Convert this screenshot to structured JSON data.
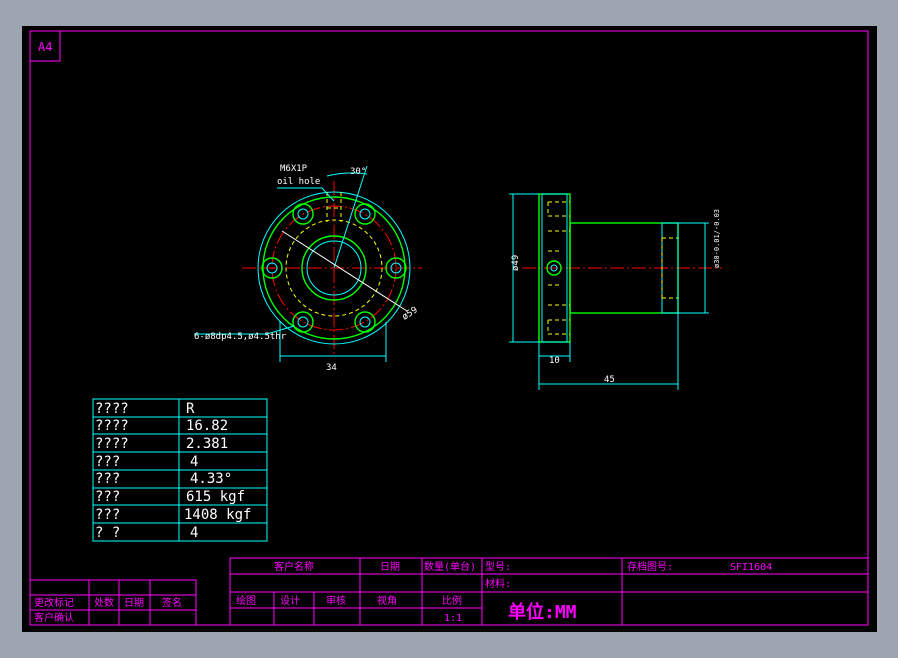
{
  "sheet": {
    "size": "A4"
  },
  "front_view": {
    "thread_label": "M6X1P",
    "oil_hole_label": "oil hole",
    "angle_label": "30°",
    "diameter_label": "ø59",
    "holes_label": "6-ø8dp4.5,ø4.5thr",
    "width_dim": "34"
  },
  "side_view": {
    "flange_dia": "ø49",
    "body_dia": "ø30-0.01/-0.03",
    "flange_thickness": "10",
    "length": "45"
  },
  "spec_table": [
    {
      "label": "????",
      "value": "R"
    },
    {
      "label": "????",
      "value": "16.82"
    },
    {
      "label": "????",
      "value": "2.381"
    },
    {
      "label": " ???",
      "value": "4"
    },
    {
      "label": " ???",
      "value": "4.33°"
    },
    {
      "label": " ???",
      "value": "615 kgf"
    },
    {
      "label": " ???",
      "value": "1408 kgf"
    },
    {
      "label": " ?  ?",
      "value": "4"
    }
  ],
  "revision_block": {
    "change_mark": "更改标记",
    "location": "处数",
    "date": "日期",
    "signature": "签名",
    "customer_confirm": "客户确认"
  },
  "title_block": {
    "customer_name": "客户名称",
    "date": "日期",
    "quantity": "数量(单台)",
    "model": "型号:",
    "archive_no": "存档图号:",
    "archive_value": "SFI1604",
    "material": "材料:",
    "drawn": "绘图",
    "design": "设计",
    "review": "审核",
    "projection": "视角",
    "scale": "比例",
    "scale_value": "1:1",
    "unit": "单位:MM"
  }
}
